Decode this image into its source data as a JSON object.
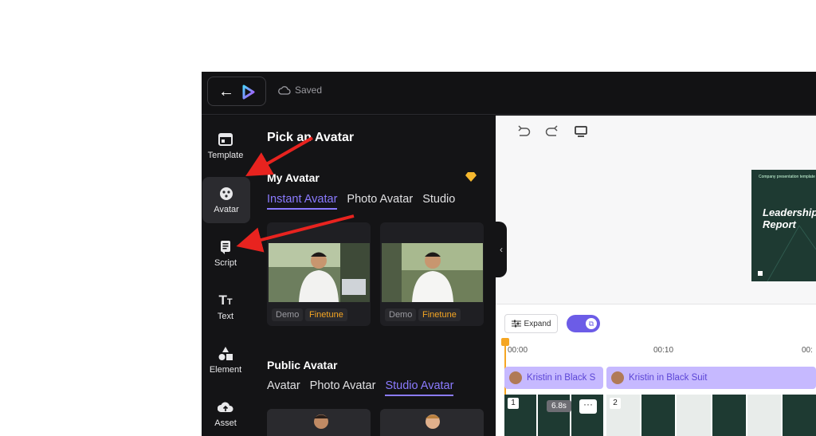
{
  "topbar": {
    "back_icon": "arrow-left-icon",
    "logo": "app-logo",
    "saved_label": "Saved"
  },
  "sidebar": {
    "items": [
      {
        "label": "Template",
        "icon": "template-icon"
      },
      {
        "label": "Avatar",
        "icon": "avatar-icon",
        "active": true
      },
      {
        "label": "Script",
        "icon": "script-icon"
      },
      {
        "label": "Text",
        "icon": "text-icon"
      },
      {
        "label": "Element",
        "icon": "element-icon"
      },
      {
        "label": "Asset",
        "icon": "upload-cloud-icon"
      }
    ]
  },
  "panel": {
    "title": "Pick an Avatar",
    "my_avatar": {
      "title": "My Avatar",
      "premium_icon": "diamond-icon",
      "tabs": [
        "Instant Avatar",
        "Photo Avatar",
        "Studio"
      ],
      "active_tab": "Instant Avatar",
      "cards": [
        {
          "tag_demo": "Demo",
          "tag_finetune": "Finetune"
        },
        {
          "tag_demo": "Demo",
          "tag_finetune": "Finetune"
        }
      ]
    },
    "public_avatar": {
      "title": "Public Avatar",
      "tabs": [
        "Avatar",
        "Photo Avatar",
        "Studio Avatar"
      ],
      "active_tab": "Studio Avatar"
    }
  },
  "canvas": {
    "toolbar_icons": [
      "undo-icon",
      "redo-icon",
      "monitor-icon"
    ],
    "slide": {
      "small": "Company presentation template",
      "big": "Leadership Report"
    }
  },
  "timeline": {
    "expand_label": "Expand",
    "ruler": [
      "00:00",
      "00:10",
      "00:"
    ],
    "avatar_tracks": [
      "Kristin in Black S",
      "Kristin in Black Suit"
    ],
    "duration": "6.8s",
    "more_label": "···",
    "slide_numbers": [
      "1",
      "2"
    ]
  }
}
